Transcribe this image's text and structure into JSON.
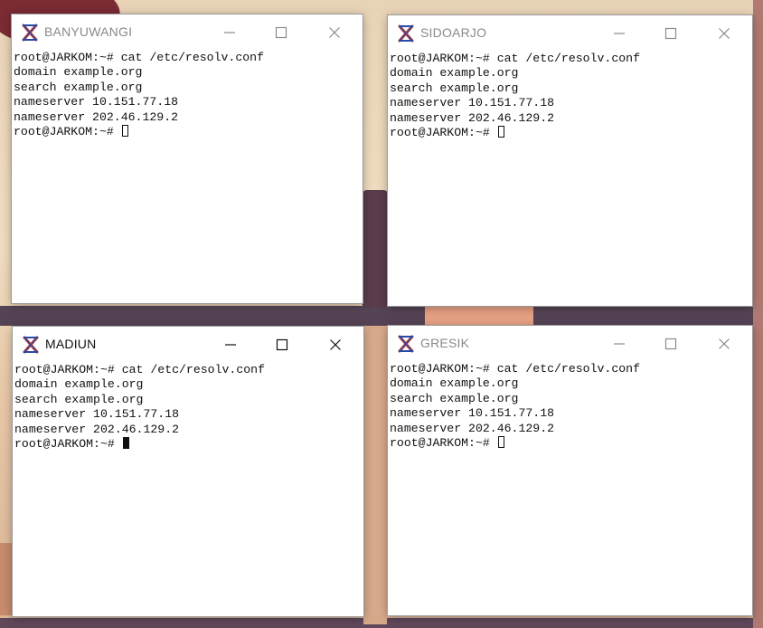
{
  "windows": [
    {
      "title": "BANYUWANGI",
      "app_icon": "xterm-icon",
      "active": false,
      "lines": [
        "root@JARKOM:~# cat /etc/resolv.conf",
        "domain example.org",
        "search example.org",
        "nameserver 10.151.77.18",
        "nameserver 202.46.129.2"
      ],
      "prompt": "root@JARKOM:~# ",
      "cursor": "hollow"
    },
    {
      "title": "SIDOARJO",
      "app_icon": "xterm-icon",
      "active": false,
      "lines": [
        "root@JARKOM:~# cat /etc/resolv.conf",
        "domain example.org",
        "search example.org",
        "nameserver 10.151.77.18",
        "nameserver 202.46.129.2"
      ],
      "prompt": "root@JARKOM:~# ",
      "cursor": "hollow"
    },
    {
      "title": "MADIUN",
      "app_icon": "xterm-icon",
      "active": true,
      "lines": [
        "root@JARKOM:~# cat /etc/resolv.conf",
        "domain example.org",
        "search example.org",
        "nameserver 10.151.77.18",
        "nameserver 202.46.129.2"
      ],
      "prompt": "root@JARKOM:~# ",
      "cursor": "filled"
    },
    {
      "title": "GRESIK",
      "app_icon": "xterm-icon",
      "active": false,
      "lines": [
        "root@JARKOM:~# cat /etc/resolv.conf",
        "domain example.org",
        "search example.org",
        "nameserver 10.151.77.18",
        "nameserver 202.46.129.2"
      ],
      "prompt": "root@JARKOM:~# ",
      "cursor": "hollow"
    }
  ],
  "icons": {
    "minimize": "minimize-icon",
    "maximize": "maximize-icon",
    "close": "close-icon"
  }
}
